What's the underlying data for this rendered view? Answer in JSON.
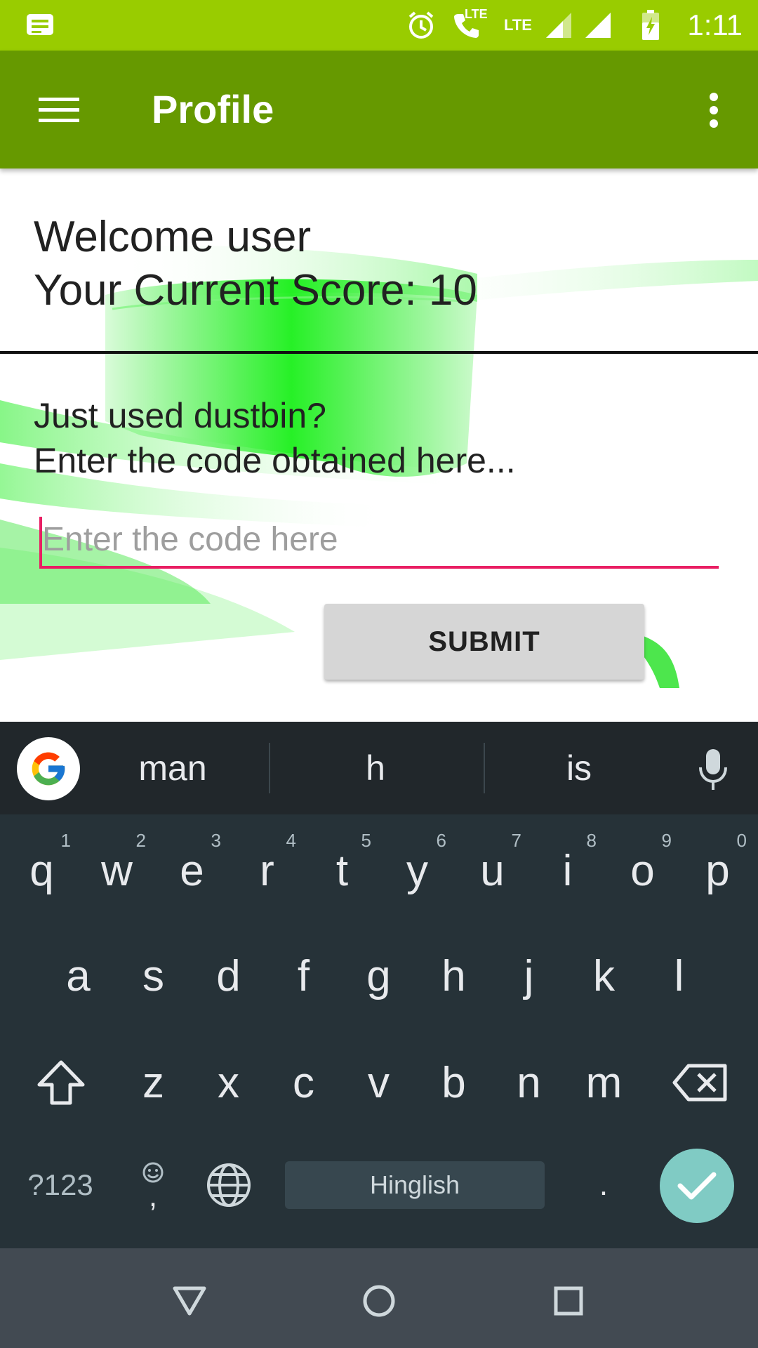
{
  "status_bar": {
    "time": "1:11",
    "lte_1": "LTE",
    "lte_2": "LTE",
    "icons": [
      "notification-icon",
      "alarm-icon",
      "volte-call-icon",
      "signal-icon",
      "signal-icon",
      "battery-charging-icon"
    ]
  },
  "app_bar": {
    "title": "Profile",
    "menu_icon": "hamburger-menu-icon",
    "overflow_icon": "more-vert-icon",
    "color": "#669900"
  },
  "profile": {
    "welcome": "Welcome user",
    "score_label": "Your Current Score: 10"
  },
  "code_form": {
    "prompt_line1": "Just used dustbin?",
    "prompt_line2": "Enter the code obtained here...",
    "input_value": "",
    "input_placeholder": "Enter the code here",
    "submit_label": "SUBMIT",
    "accent_color": "#e91e63"
  },
  "keyboard": {
    "suggestions": [
      "man",
      "h",
      "is"
    ],
    "row1": [
      {
        "key": "q",
        "hint": "1"
      },
      {
        "key": "w",
        "hint": "2"
      },
      {
        "key": "e",
        "hint": "3"
      },
      {
        "key": "r",
        "hint": "4"
      },
      {
        "key": "t",
        "hint": "5"
      },
      {
        "key": "y",
        "hint": "6"
      },
      {
        "key": "u",
        "hint": "7"
      },
      {
        "key": "i",
        "hint": "8"
      },
      {
        "key": "o",
        "hint": "9"
      },
      {
        "key": "p",
        "hint": "0"
      }
    ],
    "row2": [
      "a",
      "s",
      "d",
      "f",
      "g",
      "h",
      "j",
      "k",
      "l"
    ],
    "row3": [
      "z",
      "x",
      "c",
      "v",
      "b",
      "n",
      "m"
    ],
    "symbols_label": "?123",
    "comma_label": ",",
    "space_label": "Hinglish",
    "period_label": ".",
    "enter_color": "#80cbc4"
  },
  "nav_bar": {
    "icons": [
      "back-icon",
      "home-icon",
      "recents-icon"
    ]
  }
}
